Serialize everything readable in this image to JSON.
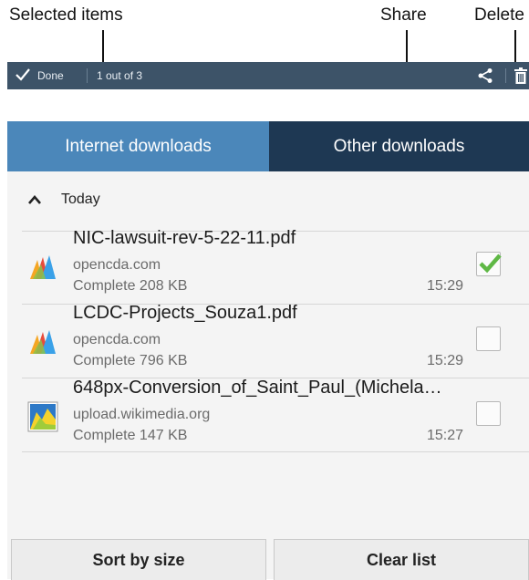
{
  "callouts": {
    "selected_items": "Selected items",
    "share": "Share",
    "delete": "Delete"
  },
  "action_bar": {
    "done_label": "Done",
    "selection_count": "1 out of 3"
  },
  "tabs": [
    {
      "label": "Internet downloads",
      "active": true
    },
    {
      "label": "Other downloads",
      "active": false
    }
  ],
  "group": {
    "label": "Today"
  },
  "items": [
    {
      "title": "NIC-lawsuit-rev-5-22-11.pdf",
      "domain": "opencda.com",
      "status": "Complete  208 KB",
      "time": "15:29",
      "checked": true,
      "icon": "pdf-document-icon"
    },
    {
      "title": "LCDC-Projects_Souza1.pdf",
      "domain": "opencda.com",
      "status": "Complete  796 KB",
      "time": "15:29",
      "checked": false,
      "icon": "pdf-document-icon"
    },
    {
      "title": "648px-Conversion_of_Saint_Paul_(Michela…",
      "domain": "upload.wikimedia.org",
      "status": "Complete  147 KB",
      "time": "15:27",
      "checked": false,
      "icon": "image-file-icon"
    }
  ],
  "buttons": {
    "sort": "Sort by size",
    "clear": "Clear list"
  },
  "colors": {
    "action_bar": "#3d5368",
    "tab_active": "#4b87ba",
    "tab_inactive": "#1e3853",
    "check_green": "#5fb845"
  }
}
